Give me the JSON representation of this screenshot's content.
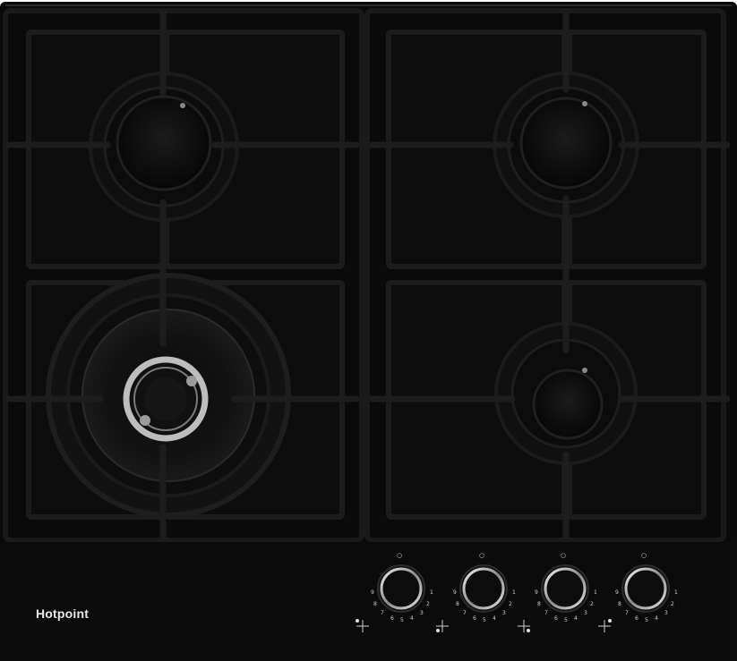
{
  "brand": {
    "name": "Hotpoint"
  },
  "knobs": [
    {
      "off_symbol": "○",
      "scale": [
        "9",
        "8",
        "7",
        "6",
        "5",
        "4",
        "3",
        "2",
        "1"
      ]
    },
    {
      "off_symbol": "○",
      "scale": [
        "9",
        "8",
        "7",
        "6",
        "5",
        "4",
        "3",
        "2",
        "1"
      ]
    },
    {
      "off_symbol": "○",
      "scale": [
        "9",
        "8",
        "7",
        "6",
        "5",
        "4",
        "3",
        "2",
        "1"
      ]
    },
    {
      "off_symbol": "○",
      "scale": [
        "9",
        "8",
        "7",
        "6",
        "5",
        "4",
        "3",
        "2",
        "1"
      ]
    }
  ],
  "colors": {
    "glass": "#0b0b0b",
    "cast_iron": "#141414",
    "burner": "#101010",
    "chrome": "#d9d9d9",
    "text": "#e9e9e9"
  }
}
